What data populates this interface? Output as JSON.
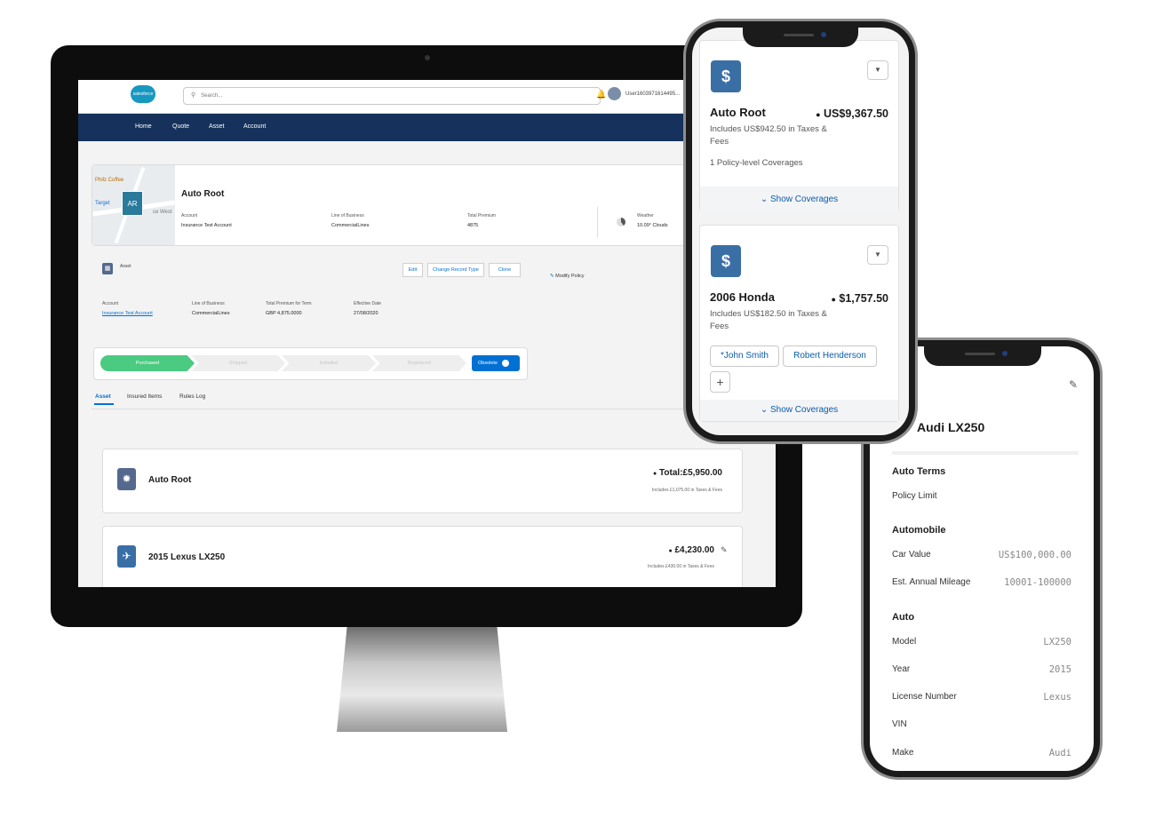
{
  "desktop": {
    "header": {
      "logo_text": "salesforce",
      "search_placeholder": "Search...",
      "user": "User1603971614495..."
    },
    "nav": [
      "Home",
      "Quote",
      "Asset",
      "Account"
    ],
    "record": {
      "map_labels": [
        "Philz Coffee",
        "Target",
        "ce West"
      ],
      "badge": "AR",
      "title": "Auto Root",
      "fields": [
        {
          "label": "Account",
          "value": "Insurance Test Account"
        },
        {
          "label": "Line of Business",
          "value": "CommercialLines"
        },
        {
          "label": "Total Premium",
          "value": "4875"
        },
        {
          "label": "Weather",
          "value": "10.09° Clouds"
        }
      ]
    },
    "asset": {
      "label": "Asset",
      "buttons": [
        "Edit",
        "Change Record Type",
        "Clone"
      ],
      "modify": "Modify Policy",
      "fields": [
        {
          "label": "Account",
          "value": "Insurance Test Account"
        },
        {
          "label": "Line of Business",
          "value": "CommercialLines"
        },
        {
          "label": "Total Premium for Term",
          "value": "GBP 4,875.0000"
        },
        {
          "label": "Effective Date",
          "value": "27/08/2020"
        }
      ]
    },
    "path": {
      "steps": [
        "Purchased",
        "Shipped",
        "Installed",
        "Registered"
      ],
      "action": "Obsolete"
    },
    "tabs": [
      "Asset",
      "Insured Items",
      "Rules Log"
    ],
    "items": [
      {
        "name": "Auto Root",
        "total": "Total:£5,950.00",
        "sub": "Includes £1,075.00 in Taxes & Fees"
      },
      {
        "name": "2015 Lexus LX250",
        "total": "£4,230.00",
        "sub": "Includes £430.00 in Taxes & Fees"
      }
    ]
  },
  "phone1": {
    "cards": [
      {
        "name": "Auto Root",
        "price": "US$9,367.50",
        "taxes": "Includes US$942.50 in Taxes & Fees",
        "extra": "1 Policy-level Coverages",
        "show": "Show Coverages"
      },
      {
        "name": "2006 Honda",
        "price": "$1,757.50",
        "taxes": "Includes US$182.50 in Taxes & Fees",
        "chips": [
          "*John Smith",
          "Robert Henderson"
        ],
        "add": "+",
        "show": "Show Coverages"
      }
    ]
  },
  "phone2": {
    "title": "Audi LX250",
    "sections": [
      {
        "heading": "Auto Terms",
        "rows": [
          {
            "label": "Policy Limit",
            "value": ""
          }
        ]
      },
      {
        "heading": "Automobile",
        "rows": [
          {
            "label": "Car Value",
            "value": "US$100,000.00"
          },
          {
            "label": "Est. Annual Mileage",
            "value": "10001-100000"
          }
        ]
      },
      {
        "heading": "Auto",
        "rows": [
          {
            "label": "Model",
            "value": "LX250"
          },
          {
            "label": "Year",
            "value": "2015"
          },
          {
            "label": "License Number",
            "value": "Lexus"
          },
          {
            "label": "VIN",
            "value": ""
          },
          {
            "label": "Make",
            "value": "Audi"
          }
        ]
      }
    ]
  },
  "colors": {
    "nav": "#16325c",
    "accent": "#0070d2",
    "complete": "#4bca81",
    "icon_blue": "#3a6fa6"
  }
}
